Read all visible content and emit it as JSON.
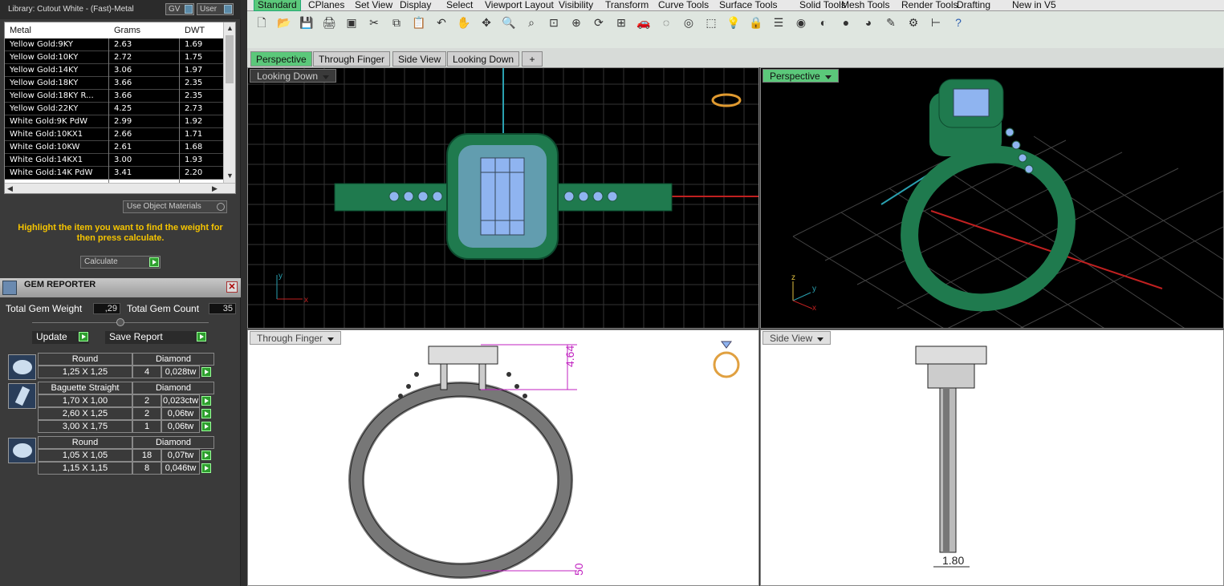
{
  "library": {
    "title": "Library: Cutout White - (Fast)-Metal",
    "gv_label": "GV",
    "user_label": "User"
  },
  "metal_table": {
    "columns": [
      "Metal",
      "Grams",
      "DWT"
    ],
    "rows": [
      [
        "Yellow Gold:9KY",
        "2.63",
        "1.69"
      ],
      [
        "Yellow Gold:10KY",
        "2.72",
        "1.75"
      ],
      [
        "Yellow Gold:14KY",
        "3.06",
        "1.97"
      ],
      [
        "Yellow Gold:18KY",
        "3.66",
        "2.35"
      ],
      [
        "Yellow Gold:18KY R...",
        "3.66",
        "2.35"
      ],
      [
        "Yellow Gold:22KY",
        "4.25",
        "2.73"
      ],
      [
        "White Gold:9K PdW",
        "2.99",
        "1.92"
      ],
      [
        "White Gold:10KX1",
        "2.66",
        "1.71"
      ],
      [
        "White Gold:10KW",
        "2.61",
        "1.68"
      ],
      [
        "White Gold:14KX1",
        "3.00",
        "1.93"
      ],
      [
        "White Gold:14K PdW",
        "3.41",
        "2.20"
      ]
    ]
  },
  "use_object_materials": "Use Object Materials",
  "highlight_text": "Highlight the item you want to find the weight for then press calculate.",
  "calculate_label": "Calculate",
  "gem_reporter": {
    "title": "GEM REPORTER",
    "total_weight_label": "Total Gem Weight",
    "total_weight_value": ",29",
    "total_count_label": "Total Gem Count",
    "total_count_value": "35",
    "update_label": "Update",
    "save_report_label": "Save Report",
    "groups": [
      {
        "shape": "Round",
        "material": "Diamond",
        "rows": [
          [
            "1,25 X 1,25",
            "4",
            "0,028tw"
          ]
        ]
      },
      {
        "shape": "Baguette Straight",
        "material": "Diamond",
        "rows": [
          [
            "1,70 X 1,00",
            "2",
            "0,023ctw"
          ],
          [
            "2,60 X 1,25",
            "2",
            "0,06tw"
          ],
          [
            "3,00 X 1,75",
            "1",
            "0,06tw"
          ]
        ]
      },
      {
        "shape": "Round",
        "material": "Diamond",
        "rows": [
          [
            "1,05 X 1,05",
            "18",
            "0,07tw"
          ],
          [
            "1,15 X 1,15",
            "8",
            "0,046tw"
          ]
        ]
      }
    ]
  },
  "toolbar_tabs": [
    "Standard",
    "CPlanes",
    "Set View",
    "Display",
    "Select",
    "Viewport Layout",
    "Visibility",
    "Transform",
    "Curve Tools",
    "Surface Tools",
    "Solid Tools",
    "Mesh Tools",
    "Render Tools",
    "Drafting",
    "New in V5"
  ],
  "viewport_tabs": [
    "Perspective",
    "Through Finger",
    "Side View",
    "Looking Down"
  ],
  "viewports": {
    "top_left": "Looking Down",
    "top_right": "Perspective",
    "bottom_left": "Through Finger",
    "bottom_right": "Side View"
  },
  "dimensions": {
    "height": "4.64",
    "shank": "50",
    "width": "1.80"
  },
  "colors": {
    "ring_green": "#1f7a4e",
    "gem_blue": "#8fb4f0",
    "accent_green": "#5bc87a",
    "highlight_yellow": "#f5c400"
  }
}
